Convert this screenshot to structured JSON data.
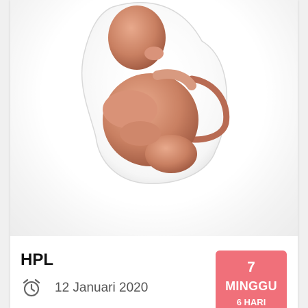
{
  "card": {
    "illustration": "fetus-illustration",
    "title": "HPL",
    "date_icon": "alarm-clock-icon",
    "date": "12 Januari 2020",
    "badge": {
      "number": "7",
      "unit": "MINGGU",
      "sub": "6 HARI",
      "color": "#f0707a"
    }
  }
}
